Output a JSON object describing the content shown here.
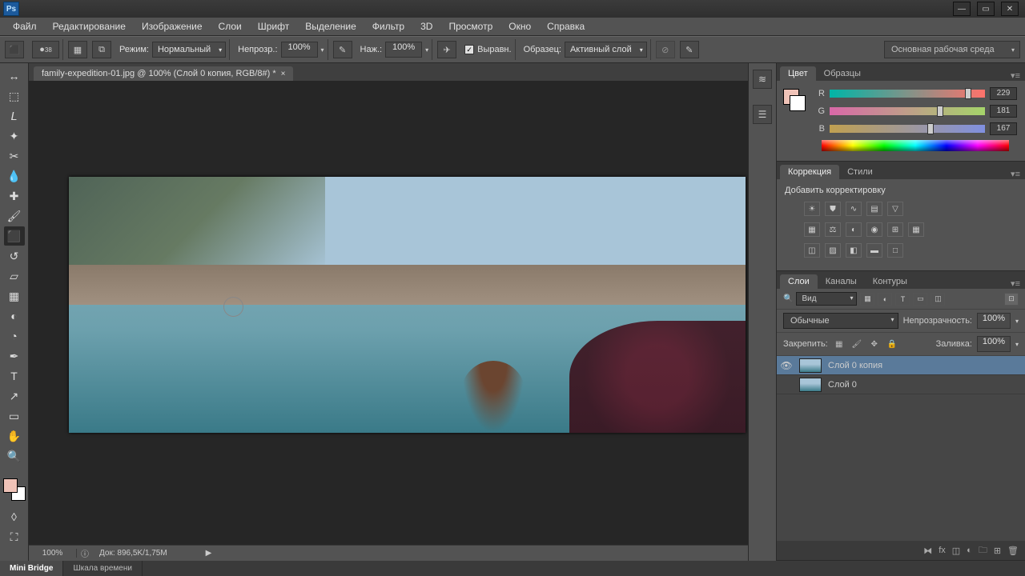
{
  "window": {
    "minimize": "—",
    "maximize": "▭",
    "close": "✕"
  },
  "menu": [
    "Файл",
    "Редактирование",
    "Изображение",
    "Слои",
    "Шрифт",
    "Выделение",
    "Фильтр",
    "3D",
    "Просмотр",
    "Окно",
    "Справка"
  ],
  "options": {
    "brush_size": "38",
    "mode_label": "Режим:",
    "mode_value": "Нормальный",
    "opacity_label": "Непрозр.:",
    "opacity_value": "100%",
    "flow_label": "Наж.:",
    "flow_value": "100%",
    "aligned_label": "Выравн.",
    "sample_label": "Образец:",
    "sample_value": "Активный слой",
    "workspace": "Основная рабочая среда"
  },
  "document": {
    "tab_title": "family-expedition-01.jpg @ 100% (Слой 0 копия, RGB/8#) *",
    "zoom": "100%",
    "doc_info": "Док: 896,5K/1,75M"
  },
  "color_panel": {
    "tabs": [
      "Цвет",
      "Образцы"
    ],
    "r_label": "R",
    "r_value": "229",
    "g_label": "G",
    "g_value": "181",
    "b_label": "B",
    "b_value": "167"
  },
  "correction_panel": {
    "tabs": [
      "Коррекция",
      "Стили"
    ],
    "add_label": "Добавить корректировку"
  },
  "layers_panel": {
    "tabs": [
      "Слои",
      "Каналы",
      "Контуры"
    ],
    "filter_kind": "Вид",
    "blend_mode": "Обычные",
    "opacity_label": "Непрозрачность:",
    "opacity_value": "100%",
    "lock_label": "Закрепить:",
    "fill_label": "Заливка:",
    "fill_value": "100%",
    "layers": [
      {
        "name": "Слой 0 копия",
        "visible": true,
        "selected": true
      },
      {
        "name": "Слой 0",
        "visible": false,
        "selected": false
      }
    ]
  },
  "bottom_tabs": [
    "Mini Bridge",
    "Шкала времени"
  ]
}
